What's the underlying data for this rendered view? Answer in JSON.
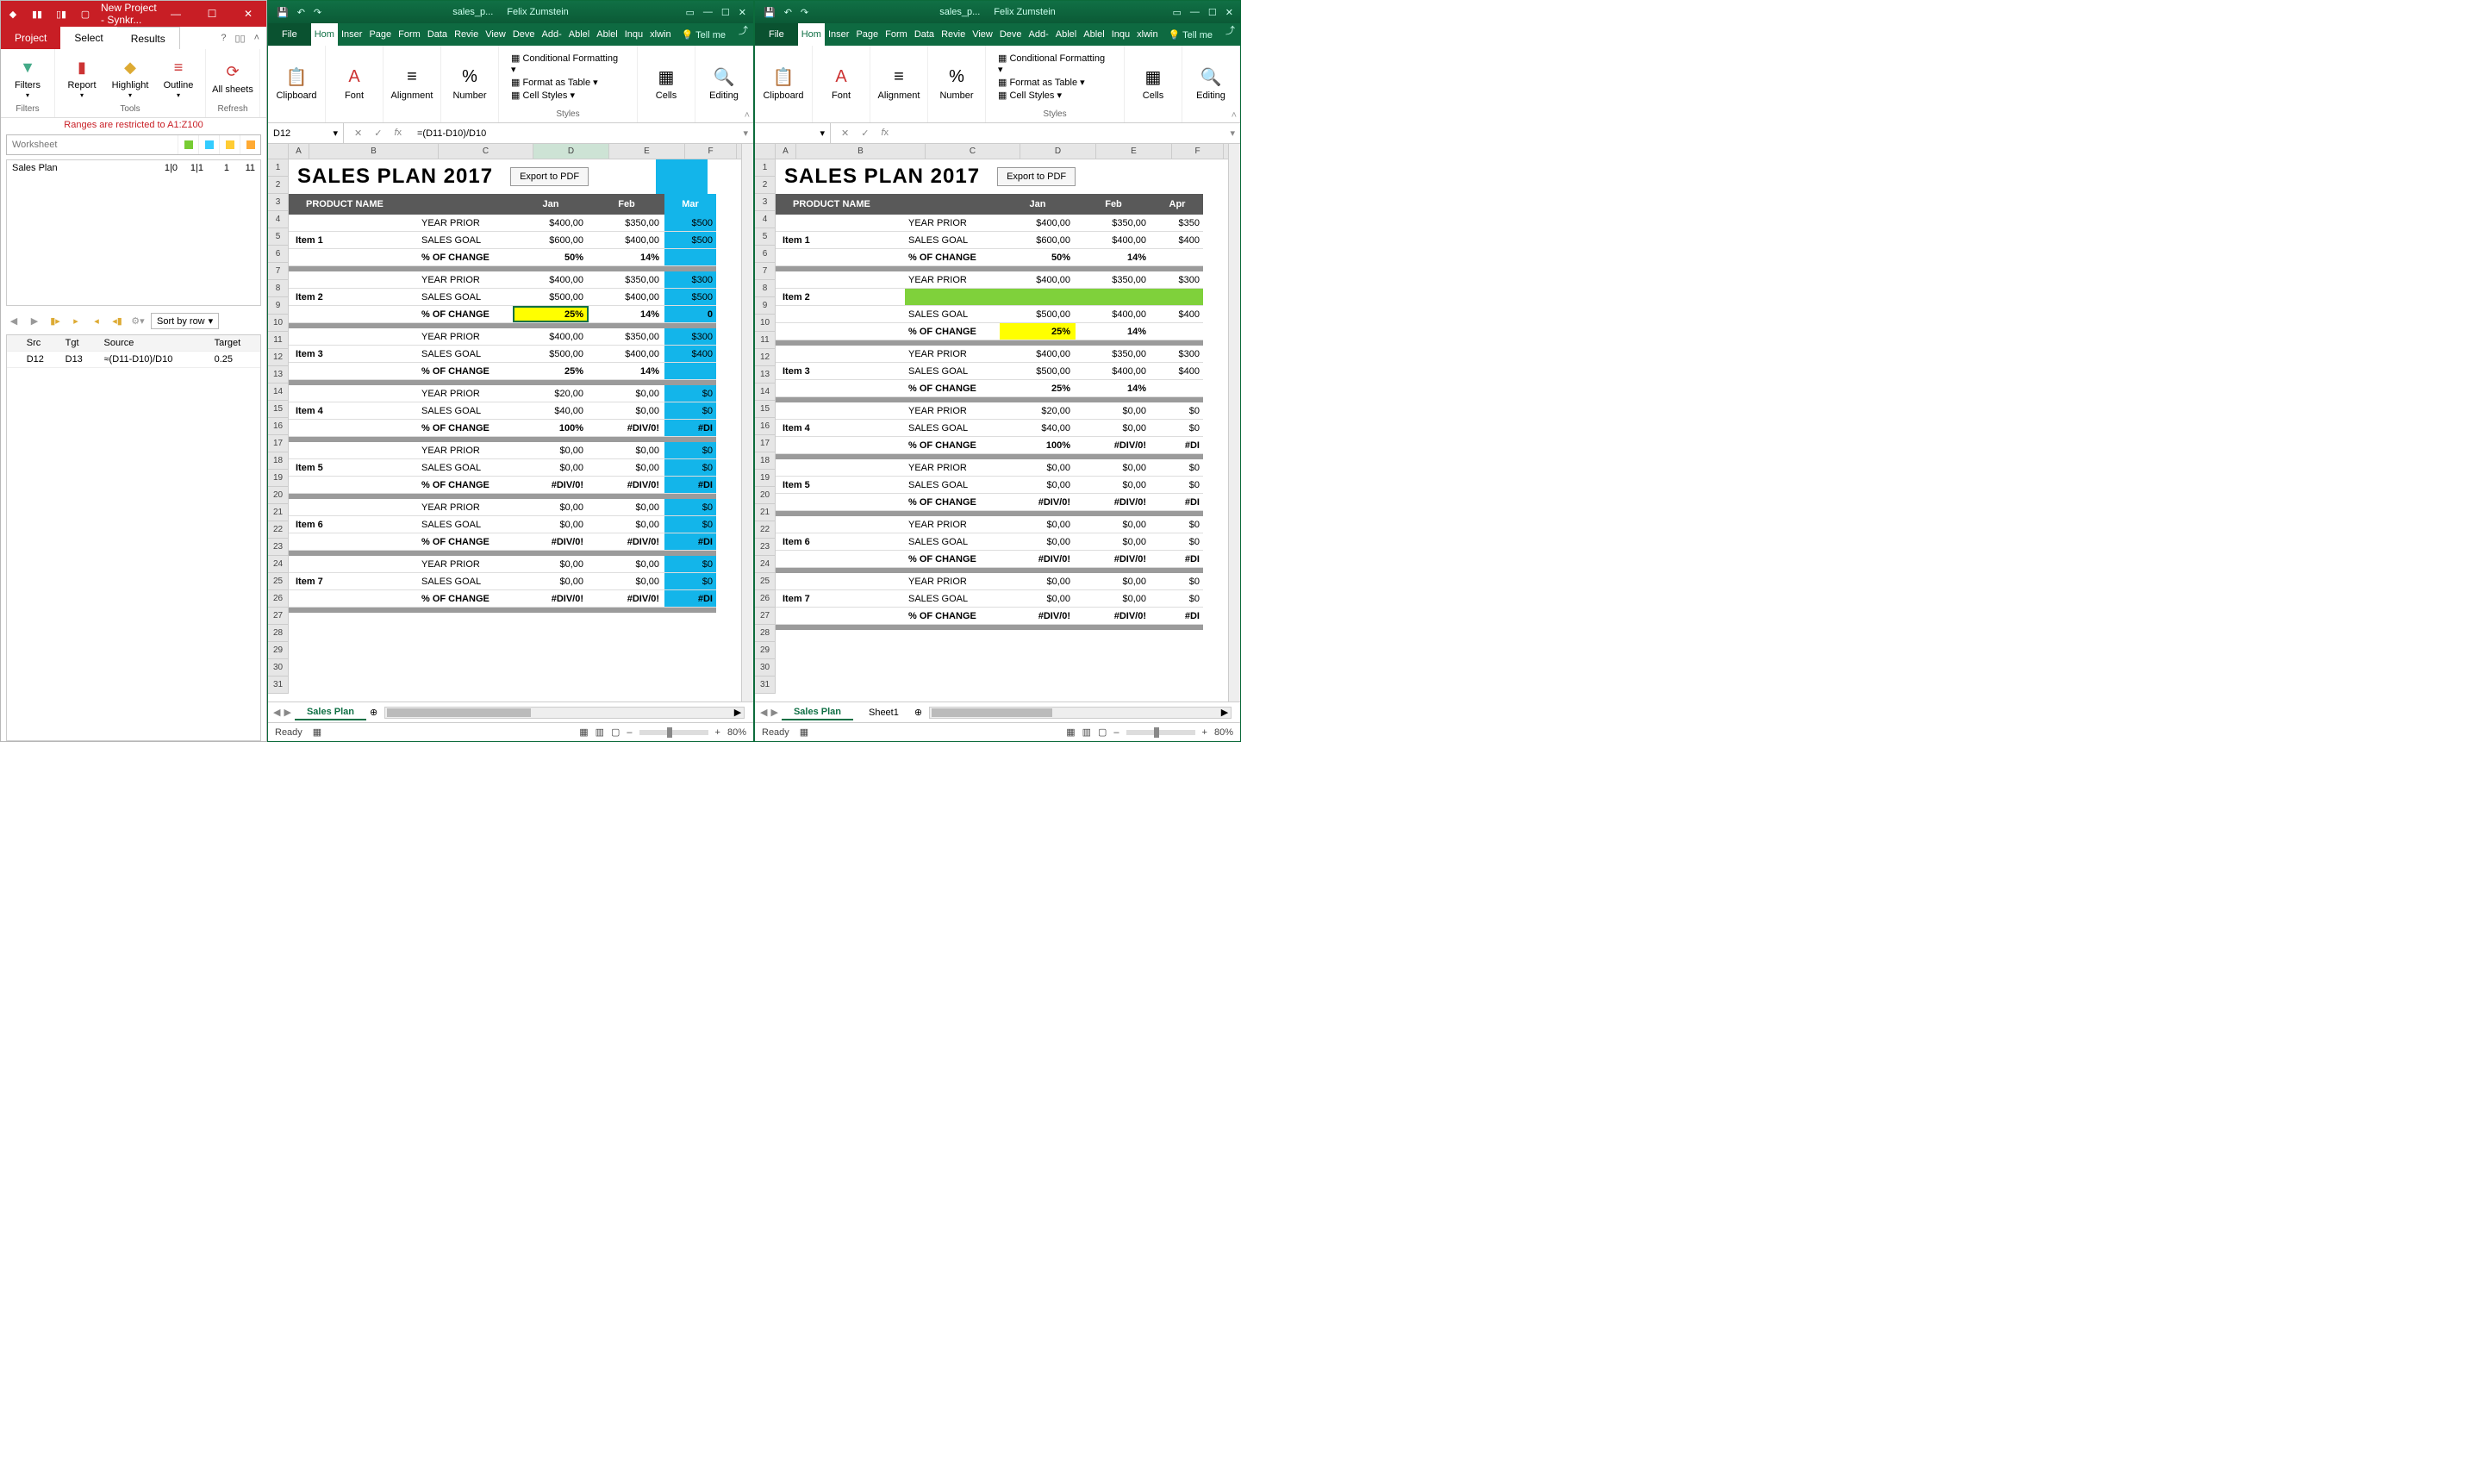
{
  "synk": {
    "title": "New Project - Synkr...",
    "tabs": {
      "project": "Project",
      "select": "Select",
      "results": "Results"
    },
    "ribbon": {
      "filters_group": "Filters",
      "tools_group": "Tools",
      "refresh_group": "Refresh",
      "filters": "Filters",
      "report": "Report",
      "highlight": "Highlight",
      "outline": "Outline",
      "allsheets": "All sheets"
    },
    "restrict": "Ranges are restricted to A1:Z100",
    "worksheet_placeholder": "Worksheet",
    "sheet": {
      "name": "Sales Plan",
      "c1": "1|0",
      "c2": "1|1",
      "c3": "1",
      "c4": "11"
    },
    "sortby": "Sort by row",
    "headers": {
      "src": "Src",
      "tgt": "Tgt",
      "source": "Source",
      "target": "Target"
    },
    "row": {
      "src": "D12",
      "tgt": "D13",
      "source": "≈(D11-D10)/D10",
      "target": "0.25"
    }
  },
  "excel_left": {
    "doc": "sales_p...",
    "user": "Felix Zumstein",
    "tabs": [
      "File",
      "Hom",
      "Inser",
      "Page",
      "Form",
      "Data",
      "Revie",
      "View",
      "Deve",
      "Add-",
      "Ablel",
      "Ablel",
      "Inqu",
      "xlwin"
    ],
    "tellme": "Tell me",
    "ribbon": {
      "clipboard": "Clipboard",
      "font": "Font",
      "alignment": "Alignment",
      "number": "Number",
      "styles": "Styles",
      "cells": "Cells",
      "editing": "Editing",
      "condfmt": "Conditional Formatting",
      "fmttable": "Format as Table",
      "cellstyles": "Cell Styles"
    },
    "namebox": "D12",
    "formula": "=(D11-D10)/D10",
    "cols": [
      "A",
      "B",
      "C",
      "D",
      "E",
      "F"
    ],
    "title": "SALES PLAN 2017",
    "export": "Export to PDF",
    "header": {
      "pname": "PRODUCT NAME",
      "m1": "Jan",
      "m2": "Feb",
      "m3": "Mar"
    },
    "items": [
      {
        "name": "Item 1",
        "yp": [
          "$400,00",
          "$350,00",
          "$500"
        ],
        "sg": [
          "$600,00",
          "$400,00",
          "$500"
        ],
        "pc": [
          "50%",
          "14%",
          ""
        ]
      },
      {
        "name": "Item 2",
        "yp": [
          "$400,00",
          "$350,00",
          "$300"
        ],
        "sg": [
          "$500,00",
          "$400,00",
          "$500"
        ],
        "pc": [
          "25%",
          "14%",
          "0"
        ]
      },
      {
        "name": "Item 3",
        "yp": [
          "$400,00",
          "$350,00",
          "$300"
        ],
        "sg": [
          "$500,00",
          "$400,00",
          "$400"
        ],
        "pc": [
          "25%",
          "14%",
          ""
        ]
      },
      {
        "name": "Item 4",
        "yp": [
          "$20,00",
          "$0,00",
          "$0"
        ],
        "sg": [
          "$40,00",
          "$0,00",
          "$0"
        ],
        "pc": [
          "100%",
          "#DIV/0!",
          "#DI"
        ]
      },
      {
        "name": "Item 5",
        "yp": [
          "$0,00",
          "$0,00",
          "$0"
        ],
        "sg": [
          "$0,00",
          "$0,00",
          "$0"
        ],
        "pc": [
          "#DIV/0!",
          "#DIV/0!",
          "#DI"
        ]
      },
      {
        "name": "Item 6",
        "yp": [
          "$0,00",
          "$0,00",
          "$0"
        ],
        "sg": [
          "$0,00",
          "$0,00",
          "$0"
        ],
        "pc": [
          "#DIV/0!",
          "#DIV/0!",
          "#DI"
        ]
      },
      {
        "name": "Item 7",
        "yp": [
          "$0,00",
          "$0,00",
          "$0"
        ],
        "sg": [
          "$0,00",
          "$0,00",
          "$0"
        ],
        "pc": [
          "#DIV/0!",
          "#DIV/0!",
          "#DI"
        ]
      }
    ],
    "labels": {
      "yp": "YEAR PRIOR",
      "sg": "SALES GOAL",
      "pc": "% OF CHANGE"
    },
    "sheettab": "Sales Plan",
    "ready": "Ready",
    "zoom": "80%"
  },
  "excel_right": {
    "doc": "sales_p...",
    "user": "Felix Zumstein",
    "tabs": [
      "File",
      "Hom",
      "Inser",
      "Page",
      "Form",
      "Data",
      "Revie",
      "View",
      "Deve",
      "Add-",
      "Ablel",
      "Ablel",
      "Inqu",
      "xlwin"
    ],
    "tellme": "Tell me",
    "ribbon": {
      "clipboard": "Clipboard",
      "font": "Font",
      "alignment": "Alignment",
      "number": "Number",
      "styles": "Styles",
      "cells": "Cells",
      "editing": "Editing",
      "condfmt": "Conditional Formatting",
      "fmttable": "Format as Table",
      "cellstyles": "Cell Styles"
    },
    "namebox": "",
    "formula": "",
    "cols": [
      "A",
      "B",
      "C",
      "D",
      "E",
      "F"
    ],
    "title": "SALES PLAN 2017",
    "export": "Export to PDF",
    "header": {
      "pname": "PRODUCT NAME",
      "m1": "Jan",
      "m2": "Feb",
      "m3": "Apr"
    },
    "items": [
      {
        "name": "Item 1",
        "yp": [
          "$400,00",
          "$350,00",
          "$350"
        ],
        "sg": [
          "$600,00",
          "$400,00",
          "$400"
        ],
        "pc": [
          "50%",
          "14%",
          ""
        ]
      },
      {
        "name": "Item 2",
        "yp": [
          "$400,00",
          "$350,00",
          "$300"
        ],
        "sg": [
          "$500,00",
          "$400,00",
          "$400"
        ],
        "pc": [
          "25%",
          "14%",
          ""
        ],
        "greenrow": true
      },
      {
        "name": "Item 3",
        "yp": [
          "$400,00",
          "$350,00",
          "$300"
        ],
        "sg": [
          "$500,00",
          "$400,00",
          "$400"
        ],
        "pc": [
          "25%",
          "14%",
          ""
        ]
      },
      {
        "name": "Item 4",
        "yp": [
          "$20,00",
          "$0,00",
          "$0"
        ],
        "sg": [
          "$40,00",
          "$0,00",
          "$0"
        ],
        "pc": [
          "100%",
          "#DIV/0!",
          "#DI"
        ]
      },
      {
        "name": "Item 5",
        "yp": [
          "$0,00",
          "$0,00",
          "$0"
        ],
        "sg": [
          "$0,00",
          "$0,00",
          "$0"
        ],
        "pc": [
          "#DIV/0!",
          "#DIV/0!",
          "#DI"
        ]
      },
      {
        "name": "Item 6",
        "yp": [
          "$0,00",
          "$0,00",
          "$0"
        ],
        "sg": [
          "$0,00",
          "$0,00",
          "$0"
        ],
        "pc": [
          "#DIV/0!",
          "#DIV/0!",
          "#DI"
        ]
      },
      {
        "name": "Item 7",
        "yp": [
          "$0,00",
          "$0,00",
          "$0"
        ],
        "sg": [
          "$0,00",
          "$0,00",
          "$0"
        ],
        "pc": [
          "#DIV/0!",
          "#DIV/0!",
          "#DI"
        ]
      }
    ],
    "labels": {
      "yp": "YEAR PRIOR",
      "sg": "SALES GOAL",
      "pc": "% OF CHANGE"
    },
    "sheettabs": [
      "Sales Plan",
      "Sheet1"
    ],
    "ready": "Ready",
    "zoom": "80%"
  }
}
